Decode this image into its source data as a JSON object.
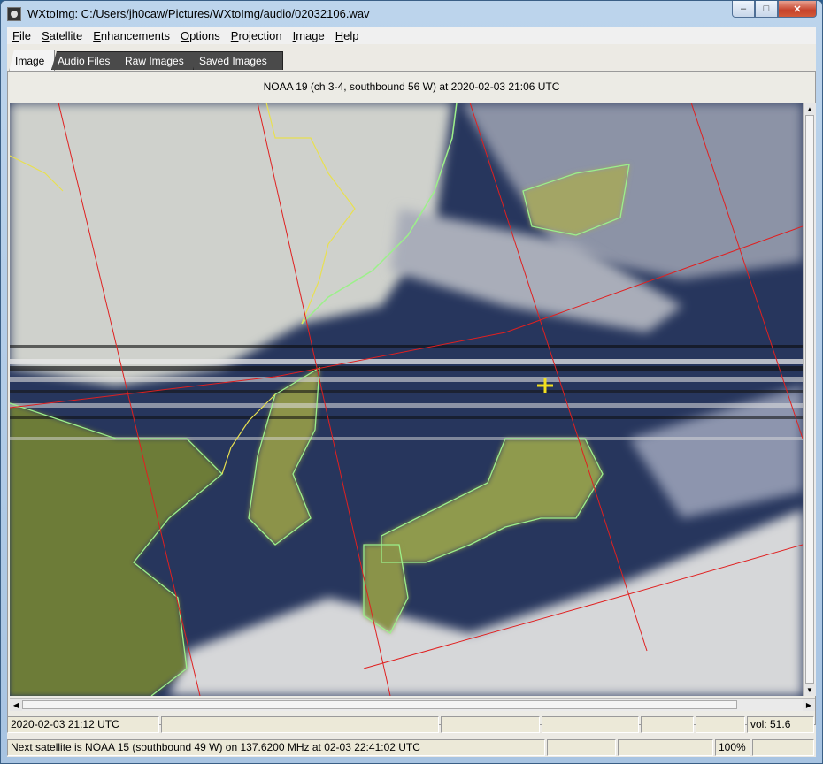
{
  "window": {
    "title": "WXtoImg: C:/Users/jh0caw/Pictures/WXtoImg/audio/02032106.wav",
    "controls": {
      "minimize": "‒",
      "maximize": "□",
      "close": "✕"
    }
  },
  "menu": [
    "File",
    "Satellite",
    "Enhancements",
    "Options",
    "Projection",
    "Image",
    "Help"
  ],
  "tabs": [
    {
      "label": "Image",
      "active": true
    },
    {
      "label": "Audio Files",
      "active": false
    },
    {
      "label": "Raw Images",
      "active": false
    },
    {
      "label": "Saved Images",
      "active": false
    }
  ],
  "image": {
    "caption": "NOAA 19 (ch 3-4, southbound 56 W) at 2020-02-03  21:06 UTC"
  },
  "status": {
    "row1": {
      "datetime": "2020-02-03  21:12 UTC",
      "volume": "vol: 51.6"
    },
    "row2": {
      "next_satellite": "Next satellite is NOAA 15 (southbound 49 W) on 137.6200 MHz at 02-03 22:41:02 UTC",
      "zoom": "100%"
    }
  },
  "colors": {
    "grid_lines": "#e02020",
    "coastline": "#9cf08a",
    "border": "#e8e050",
    "marker": "#f2e020",
    "ocean": "#26355c",
    "land_veg": "#6d7b38"
  }
}
